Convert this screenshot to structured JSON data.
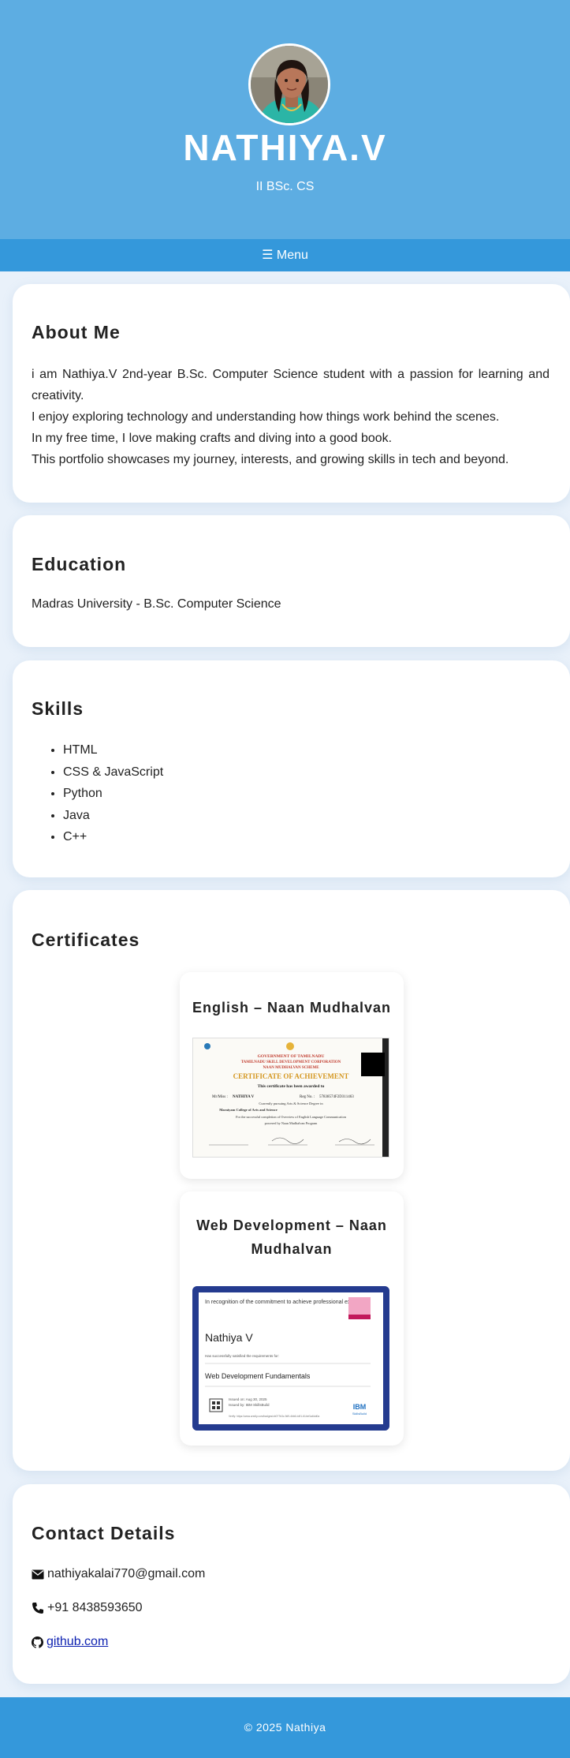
{
  "header": {
    "name": "NATHIYA.V",
    "subtitle": "II BSc. CS"
  },
  "menu": {
    "label": "☰ Menu"
  },
  "about": {
    "title": "About Me",
    "paragraphs": [
      "i am Nathiya.V 2nd-year B.Sc. Computer Science student with a passion for learning and creativity.",
      "I enjoy exploring technology and understanding how things work behind the scenes.",
      "In my free time, I love making crafts and diving into a good book.",
      "This portfolio showcases my journey, interests, and growing skills in tech and beyond."
    ]
  },
  "education": {
    "title": "Education",
    "text": "Madras University - B.Sc. Computer Science"
  },
  "skills": {
    "title": "Skills",
    "items": [
      "HTML",
      "CSS & JavaScript",
      "Python",
      "Java",
      "C++"
    ]
  },
  "certificates": {
    "title": "Certificates",
    "items": [
      {
        "title": "English – Naan Mudhalvan",
        "image": {
          "header1": "GOVERNMENT OF TAMILNADU",
          "header2": "TAMILNADU SKILL DEVELOPMENT CORPORATION",
          "header3": "NAAN MUDHALVAN SCHEME",
          "heading": "CERTIFICATE OF ACHIEVEMENT",
          "awarded": "This certificate has been awarded to",
          "name_label": "Mr/Miss :",
          "name": "NATHIYA V",
          "reg_label": "Reg No. :",
          "reg": "57838574F2D311463",
          "line1": "Currently pursuing  Arts & Science Degree in",
          "college": "Maraiyam College of Arts and Science",
          "line2": "For the successful completion of  Overview of English Language Communication",
          "line3": "powered by Naan Mudhalvan Program"
        }
      },
      {
        "title": "Web Development – Naan Mudhalvan",
        "image": {
          "recognition": "In recognition of the commitment to achieve professional excellence",
          "name": "Nathiya V",
          "statement": "Has successfully satisfied the requirements for:",
          "course": "Web Development Fundamentals",
          "issued_on": "Issued on: Aug 30, 2025",
          "issued_by": "Issued by: IBM SkillsBuild",
          "verify": "Verify: https://www.credly.com/badges/cb077b3c-9d9-4bb6-b4f1-614ef1a6dd0a",
          "brand": "IBM",
          "brand_sub": "SkillsBuild"
        }
      }
    ]
  },
  "contact": {
    "title": "Contact Details",
    "email": "nathiyakalai770@gmail.com",
    "phone": "+91 8438593650",
    "github": "github.com"
  },
  "footer": {
    "text": "© 2025 Nathiya"
  },
  "colors": {
    "header_bg": "#5dade2",
    "menu_bg": "#3498db",
    "page_bg": "#e9f1fa",
    "card_bg": "#ffffff",
    "link": "#0b1fb0"
  }
}
